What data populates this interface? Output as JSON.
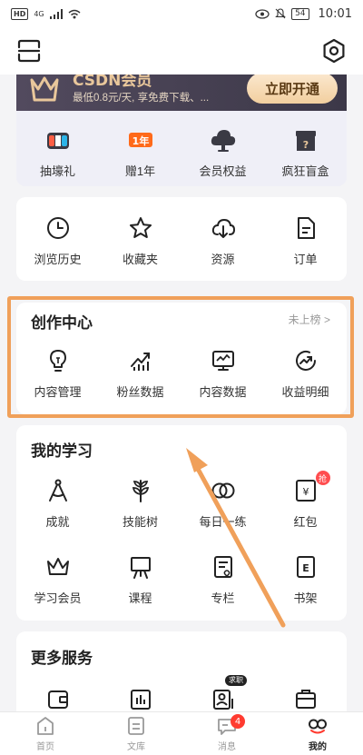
{
  "status_bar": {
    "left_badge": "HD",
    "signal": "4G",
    "battery": "54",
    "time": "10:01"
  },
  "vip": {
    "title": "CSDN会员",
    "subtitle": "最低0.8元/天, 享免费下载、...",
    "open_button": "立即开通",
    "items": [
      {
        "label": "抽壕礼",
        "icon": "gamepad-gift-icon"
      },
      {
        "label": "赠1年",
        "icon": "gift-year-icon"
      },
      {
        "label": "会员权益",
        "icon": "cloud-vip-icon"
      },
      {
        "label": "疯狂盲盒",
        "icon": "mystery-box-icon"
      }
    ]
  },
  "quick": {
    "items": [
      {
        "label": "浏览历史",
        "icon": "clock-icon"
      },
      {
        "label": "收藏夹",
        "icon": "star-icon"
      },
      {
        "label": "资源",
        "icon": "cloud-download-icon"
      },
      {
        "label": "订单",
        "icon": "order-icon"
      }
    ]
  },
  "creation": {
    "title": "创作中心",
    "rank_text": "未上榜 >",
    "items": [
      {
        "label": "内容管理",
        "icon": "lightbulb-icon"
      },
      {
        "label": "粉丝数据",
        "icon": "fans-chart-icon"
      },
      {
        "label": "内容数据",
        "icon": "monitor-chart-icon"
      },
      {
        "label": "收益明细",
        "icon": "earnings-icon"
      }
    ]
  },
  "study": {
    "title": "我的学习",
    "items": [
      {
        "label": "成就",
        "icon": "compass-icon"
      },
      {
        "label": "技能树",
        "icon": "wheat-icon"
      },
      {
        "label": "每日一练",
        "icon": "rings-icon"
      },
      {
        "label": "红包",
        "icon": "red-packet-icon",
        "badge": "抢"
      },
      {
        "label": "学习会员",
        "icon": "crown-icon"
      },
      {
        "label": "课程",
        "icon": "easel-icon"
      },
      {
        "label": "专栏",
        "icon": "column-icon"
      },
      {
        "label": "书架",
        "icon": "bookshelf-icon"
      }
    ]
  },
  "more": {
    "title": "更多服务",
    "tag": "求职",
    "items": [
      {
        "icon": "wallet-icon"
      },
      {
        "icon": "stats-icon"
      },
      {
        "icon": "job-icon"
      },
      {
        "icon": "hunt-icon"
      }
    ]
  },
  "nav": {
    "items": [
      {
        "label": "首页",
        "icon": "home-icon"
      },
      {
        "label": "文库",
        "icon": "library-icon"
      },
      {
        "label": "消息",
        "icon": "message-icon",
        "badge": "4"
      },
      {
        "label": "我的",
        "icon": "profile-icon",
        "active": true
      }
    ]
  },
  "colors": {
    "highlight": "#f0a05a",
    "vip_gold": "#e9c79b",
    "badge_red": "#ff3b30"
  }
}
